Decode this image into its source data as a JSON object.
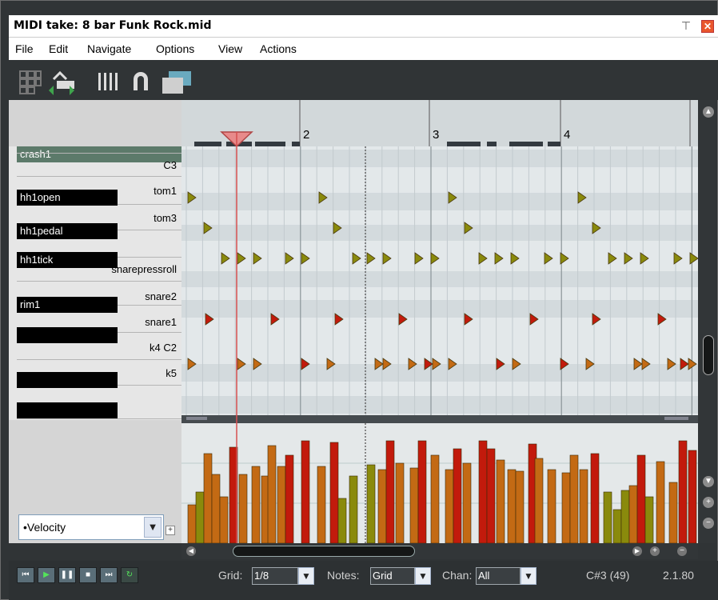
{
  "window": {
    "title": "MIDI take: 8 bar Funk Rock.mid"
  },
  "menu": [
    "File",
    "Edit",
    "Navigate",
    "Options",
    "View",
    "Actions"
  ],
  "icons": {
    "pin": "pin-icon",
    "close": "close-icon"
  },
  "keys": {
    "crash_label": "crash1",
    "labels": [
      {
        "name": "C3"
      },
      {
        "name": "tom1"
      },
      {
        "name": "tom3"
      },
      {
        "name": "snarepressroll"
      },
      {
        "name": "snare2"
      },
      {
        "name": "snare1"
      },
      {
        "name": "k4  C2"
      },
      {
        "name": "k5"
      }
    ],
    "black_labels": [
      "hh1open",
      "hh1pedal",
      "hh1tick",
      "rim1"
    ]
  },
  "ruler": {
    "bars": [
      "2",
      "3",
      "4"
    ]
  },
  "cc_lane": {
    "selected": "•Velocity"
  },
  "transport": {
    "grid_label": "Grid:",
    "grid_value": "1/8",
    "notes_label": "Notes:",
    "notes_value": "Grid",
    "chan_label": "Chan:",
    "chan_value": "All",
    "pitch_readout": "C#3 (49)",
    "position": "2.1.80"
  },
  "colors": {
    "background": "#303436",
    "grid": "#e6ebed",
    "note_red": "#c21a0c",
    "note_orange": "#c36a14",
    "note_olive": "#8a8a0c"
  }
}
